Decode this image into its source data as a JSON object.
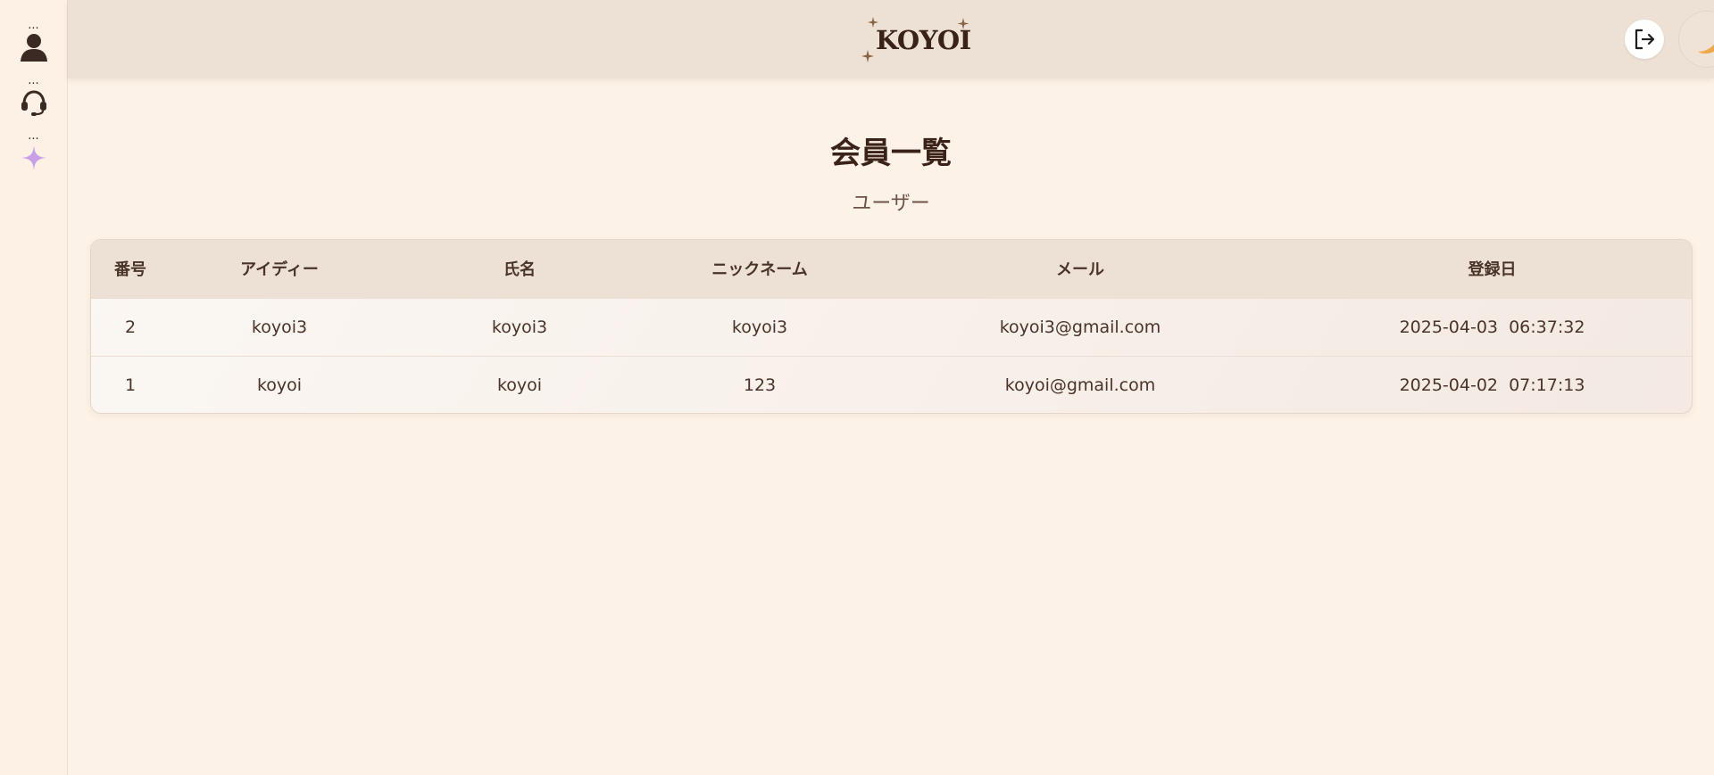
{
  "sidebar": {
    "items": [
      {
        "dots": "...",
        "icon": "user-icon"
      },
      {
        "dots": "...",
        "icon": "headset-icon"
      },
      {
        "dots": "...",
        "icon": "sparkle-icon"
      }
    ]
  },
  "header": {
    "logo": "KOYOI",
    "logout_icon": "logout-icon",
    "theme_icon": "moon-icon"
  },
  "page": {
    "title": "会員一覧",
    "subtitle": "ユーザー"
  },
  "table": {
    "headers": [
      "番号",
      "アイディー",
      "氏名",
      "ニックネーム",
      "メール",
      "登録日"
    ],
    "rows": [
      [
        "2",
        "koyoi3",
        "koyoi3",
        "koyoi3",
        "koyoi3@gmail.com",
        "2025-04-03  06:37:32"
      ],
      [
        "1",
        "koyoi",
        "koyoi",
        "123",
        "koyoi@gmail.com",
        "2025-04-02  07:17:13"
      ]
    ]
  },
  "colors": {
    "background": "#fdf2e7",
    "header": "#ede1d6",
    "text": "#3e2a22",
    "accent_sparkle": "#c9a0e8"
  }
}
